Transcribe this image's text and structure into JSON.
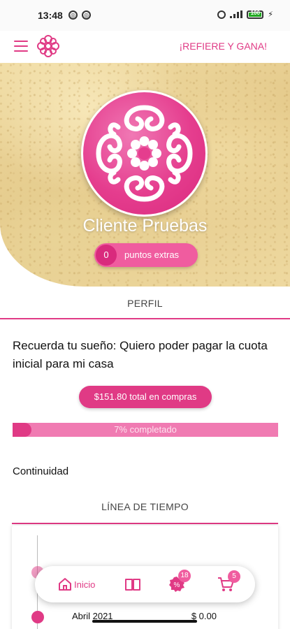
{
  "status_bar": {
    "time": "13:48",
    "battery": "100"
  },
  "header": {
    "refer_label": "¡REFIERE Y GANA!"
  },
  "profile": {
    "name": "Cliente Pruebas",
    "points_count": "0",
    "points_label": "puntos extras"
  },
  "sections": {
    "profile_title": "PERFIL",
    "timeline_title": "LÍNEA DE TIEMPO"
  },
  "dream": {
    "text": "Recuerda tu sueño: Quiero poder pagar la cuota inicial para mi casa"
  },
  "purchases": {
    "total_label": "$151.80 total en compras"
  },
  "progress": {
    "label": "7% completado",
    "value": 0.07
  },
  "continuity": {
    "label": "Continuidad"
  },
  "timeline": {
    "entries": [
      {
        "date": "Abril 2021",
        "amount": "$ 0.00"
      }
    ]
  },
  "nav": {
    "home_label": "Inicio",
    "promo_badge": "18",
    "cart_badge": "5"
  },
  "colors": {
    "accent": "#e03a85",
    "accent_light": "#f05c9f",
    "progress_bg": "#f07bb2"
  },
  "icons": [
    "menu-icon",
    "logo-icon",
    "home-icon",
    "book-icon",
    "promo-icon",
    "cart-icon"
  ]
}
